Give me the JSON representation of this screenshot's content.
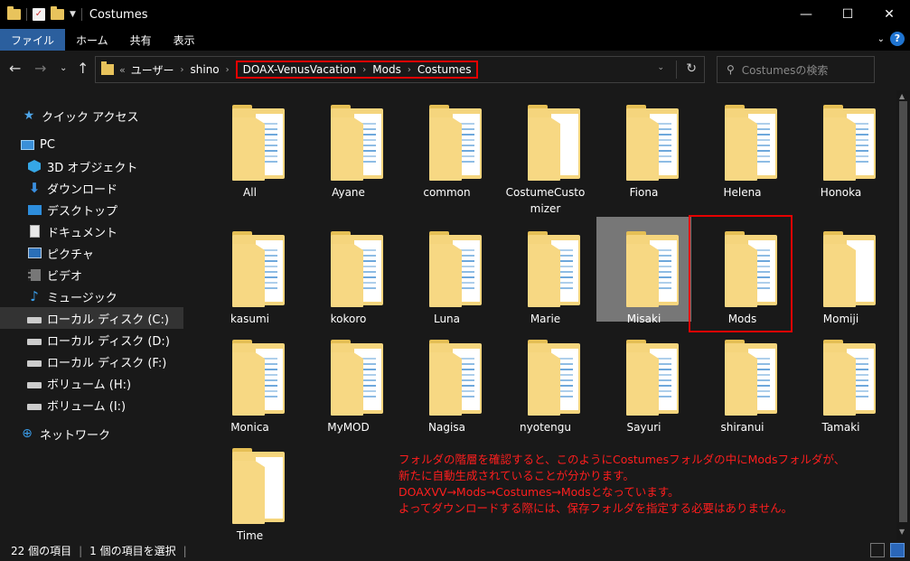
{
  "window": {
    "title": "Costumes",
    "minimize": "—",
    "maximize": "☐",
    "close": "✕"
  },
  "ribbon": {
    "tabs": [
      "ファイル",
      "ホーム",
      "共有",
      "表示"
    ],
    "help": "?"
  },
  "address": {
    "prefix": "«",
    "crumbs_plain": [
      "ユーザー",
      "shino"
    ],
    "crumbs_highlighted": [
      "DOAX-VenusVacation",
      "Mods",
      "Costumes"
    ]
  },
  "search": {
    "placeholder": "Costumesの検索"
  },
  "sidebar": {
    "quick_access": "クイック アクセス",
    "pc": "PC",
    "items": [
      {
        "label": "3D オブジェクト",
        "icon": "3d-objects-icon"
      },
      {
        "label": "ダウンロード",
        "icon": "download-icon"
      },
      {
        "label": "デスクトップ",
        "icon": "desktop-icon"
      },
      {
        "label": "ドキュメント",
        "icon": "document-icon"
      },
      {
        "label": "ピクチャ",
        "icon": "pictures-icon"
      },
      {
        "label": "ビデオ",
        "icon": "video-icon"
      },
      {
        "label": "ミュージック",
        "icon": "music-icon"
      },
      {
        "label": "ローカル ディスク (C:)",
        "icon": "drive-icon"
      },
      {
        "label": "ローカル ディスク (D:)",
        "icon": "drive-icon"
      },
      {
        "label": "ローカル ディスク (F:)",
        "icon": "drive-icon"
      },
      {
        "label": "ボリューム (H:)",
        "icon": "drive-icon"
      },
      {
        "label": "ボリューム (I:)",
        "icon": "drive-icon"
      }
    ],
    "network": "ネットワーク"
  },
  "folders": [
    {
      "label": "All"
    },
    {
      "label": "Ayane"
    },
    {
      "label": "common"
    },
    {
      "label": "CostumeCustomizer",
      "line1": "CostumeCusto",
      "line2": "mizer"
    },
    {
      "label": "Fiona"
    },
    {
      "label": "Helena"
    },
    {
      "label": "Honoka"
    },
    {
      "label": "kasumi"
    },
    {
      "label": "kokoro"
    },
    {
      "label": "Luna"
    },
    {
      "label": "Marie"
    },
    {
      "label": "Misaki"
    },
    {
      "label": "Mods"
    },
    {
      "label": "Momiji"
    },
    {
      "label": "Monica"
    },
    {
      "label": "MyMOD"
    },
    {
      "label": "Nagisa"
    },
    {
      "label": "nyotengu"
    },
    {
      "label": "Sayuri"
    },
    {
      "label": "shiranui"
    },
    {
      "label": "Tamaki"
    },
    {
      "label": "Time"
    }
  ],
  "annotation": {
    "line1": "フォルダの階層を確認すると、このようにCostumesフォルダの中にModsフォルダが、",
    "line2": "新たに自動生成されていることが分かります。",
    "line3": "DOAXVV→Mods→Costumes→Modsとなっています。",
    "line4": "よってダウンロードする際には、保存フォルダを指定する必要はありません。"
  },
  "status": {
    "count": "22 個の項目",
    "selected": "1 個の項目を選択"
  },
  "colors": {
    "highlight": "#e60000",
    "folder": "#f5d57d",
    "accent": "#2b5f9e"
  }
}
